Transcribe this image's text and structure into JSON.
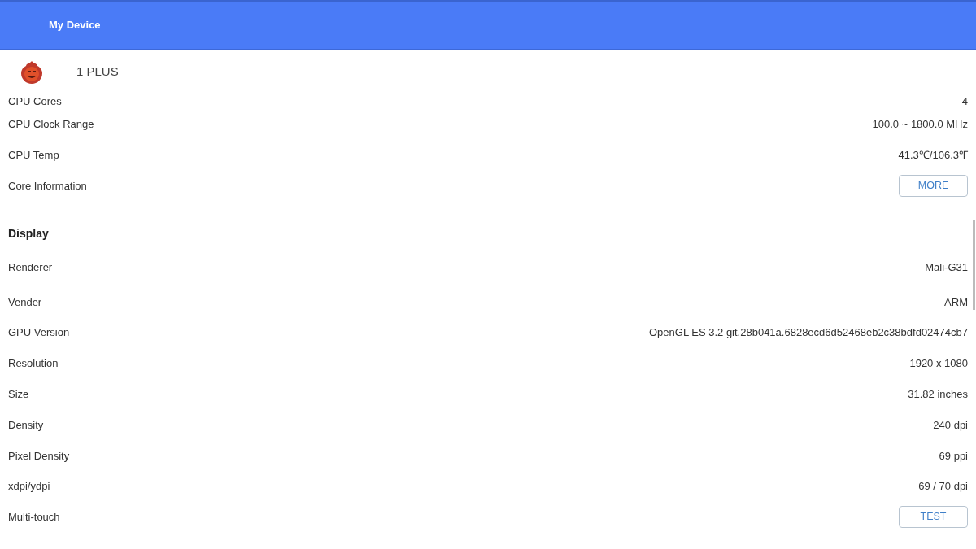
{
  "header": {
    "title": "My Device"
  },
  "device": {
    "name": "1 PLUS"
  },
  "items": [
    {
      "kind": "info",
      "label": "CPU Cores",
      "value": "4"
    },
    {
      "kind": "info",
      "label": "CPU Clock Range",
      "value": "100.0 ~ 1800.0 MHz"
    },
    {
      "kind": "info",
      "label": "CPU Temp",
      "value": "41.3℃/106.3℉"
    },
    {
      "kind": "button",
      "label": "Core Information",
      "button": "MORE"
    },
    {
      "kind": "section",
      "label": "Display"
    },
    {
      "kind": "info",
      "label": "Renderer",
      "value": "Mali-G31"
    },
    {
      "kind": "info",
      "label": "Vender",
      "value": "ARM"
    },
    {
      "kind": "info",
      "label": "GPU Version",
      "value": "OpenGL ES 3.2 git.28b041a.6828ecd6d52468eb2c38bdfd02474cb7"
    },
    {
      "kind": "info",
      "label": "Resolution",
      "value": "1920 x 1080"
    },
    {
      "kind": "info",
      "label": "Size",
      "value": "31.82 inches"
    },
    {
      "kind": "info",
      "label": "Density",
      "value": "240 dpi"
    },
    {
      "kind": "info",
      "label": "Pixel Density",
      "value": "69 ppi"
    },
    {
      "kind": "info",
      "label": "xdpi/ydpi",
      "value": "69 / 70 dpi"
    },
    {
      "kind": "button",
      "label": "Multi-touch",
      "button": "TEST"
    }
  ]
}
